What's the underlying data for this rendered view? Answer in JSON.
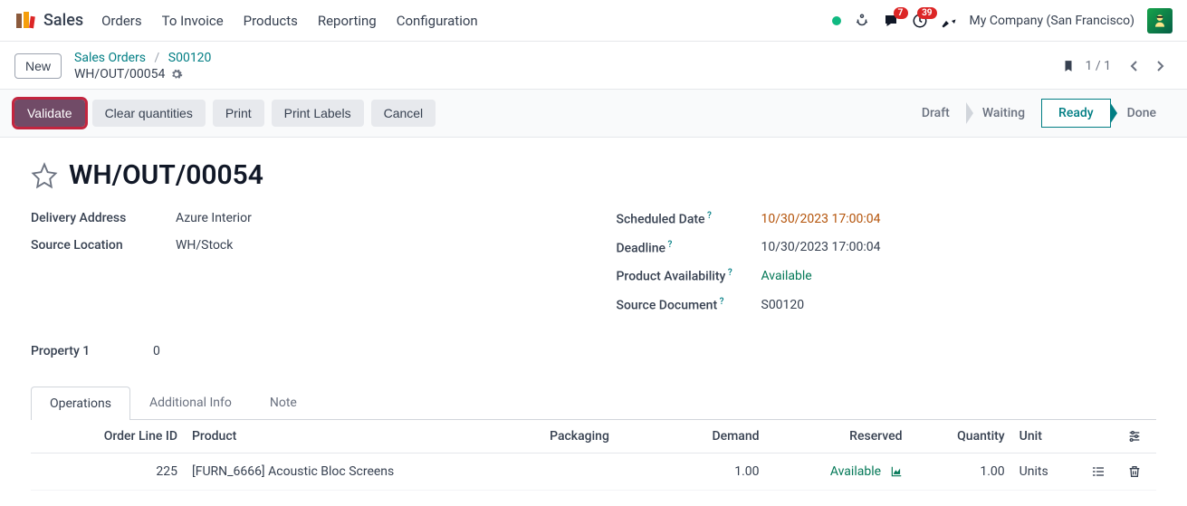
{
  "app": {
    "name": "Sales"
  },
  "nav": {
    "links": [
      "Orders",
      "To Invoice",
      "Products",
      "Reporting",
      "Configuration"
    ],
    "company": "My Company (San Francisco)",
    "msg_badge": "7",
    "activity_badge": "39"
  },
  "controlbar": {
    "new": "New",
    "bc_root": "Sales Orders",
    "bc_order": "S00120",
    "bc_doc": "WH/OUT/00054",
    "pager": "1 / 1"
  },
  "actions": {
    "validate": "Validate",
    "clear": "Clear quantities",
    "print": "Print",
    "print_labels": "Print Labels",
    "cancel": "Cancel"
  },
  "status": {
    "draft": "Draft",
    "waiting": "Waiting",
    "ready": "Ready",
    "done": "Done"
  },
  "doc": {
    "title": "WH/OUT/00054",
    "fields_left": {
      "delivery_addr_label": "Delivery Address",
      "delivery_addr_value": "Azure Interior",
      "src_loc_label": "Source Location",
      "src_loc_value": "WH/Stock",
      "prop1_label": "Property 1",
      "prop1_value": "0"
    },
    "fields_right": {
      "sched_label": "Scheduled Date",
      "sched_value": "10/30/2023 17:00:04",
      "deadline_label": "Deadline",
      "deadline_value": "10/30/2023 17:00:04",
      "avail_label": "Product Availability",
      "avail_value": "Available",
      "srcdoc_label": "Source Document",
      "srcdoc_value": "S00120"
    }
  },
  "tabs": {
    "operations": "Operations",
    "additional": "Additional Info",
    "note": "Note"
  },
  "table": {
    "headers": {
      "order_line_id": "Order Line ID",
      "product": "Product",
      "packaging": "Packaging",
      "demand": "Demand",
      "reserved": "Reserved",
      "quantity": "Quantity",
      "unit": "Unit"
    },
    "rows": [
      {
        "order_line_id": "225",
        "product": "[FURN_6666] Acoustic Bloc Screens",
        "packaging": "",
        "demand": "1.00",
        "reserved": "Available",
        "quantity": "1.00",
        "unit": "Units"
      }
    ]
  }
}
